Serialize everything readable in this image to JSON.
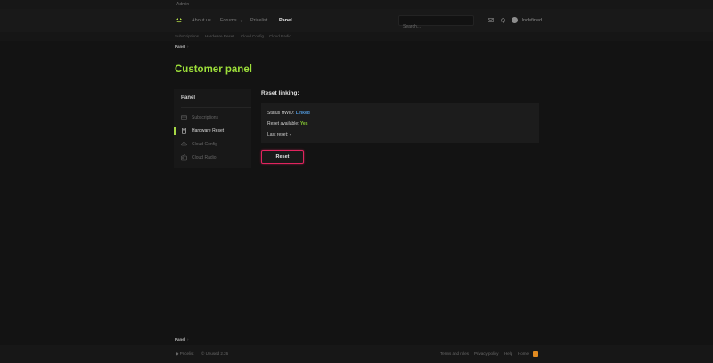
{
  "header": {
    "admin_link": "Admin",
    "nav": {
      "about": "About us",
      "forums": "Forums",
      "pricelist": "Pricelist",
      "panel": "Panel"
    },
    "search_placeholder": "Search...",
    "username": "Undefined"
  },
  "subnav": [
    "Subscriptions",
    "Hardware Reset",
    "Cloud Config",
    "Cloud Radio"
  ],
  "breadcrumb": {
    "label": "Panel",
    "chevron": "›"
  },
  "page_title": "Customer panel",
  "sidebar": {
    "header": "Panel",
    "items": [
      {
        "label": "Subscriptions",
        "icon": "card-icon",
        "active": false
      },
      {
        "label": "Hardware Reset",
        "icon": "device-icon",
        "active": true
      },
      {
        "label": "Cloud Config",
        "icon": "cloud-icon",
        "active": false
      },
      {
        "label": "Cloud Radio",
        "icon": "radio-icon",
        "active": false
      }
    ]
  },
  "main": {
    "section_title": "Reset linking:",
    "status_label": "Status HWID:",
    "status_value": "Linked",
    "reset_available_label": "Reset available:",
    "reset_available_value": "Yes",
    "last_reset_label": "Last reset:",
    "last_reset_value": "-",
    "reset_button": "Reset"
  },
  "footer": {
    "breadcrumb": "Panel",
    "chevron": "›",
    "pricelist": "Pricelist",
    "copyright": "Unused 2.26",
    "links": [
      "Terms and rules",
      "Privacy policy",
      "Help",
      "Home"
    ]
  },
  "colors": {
    "accent_green": "#9ddf3a",
    "linked_blue": "#4f95d6",
    "reset_border": "#e0245e"
  }
}
